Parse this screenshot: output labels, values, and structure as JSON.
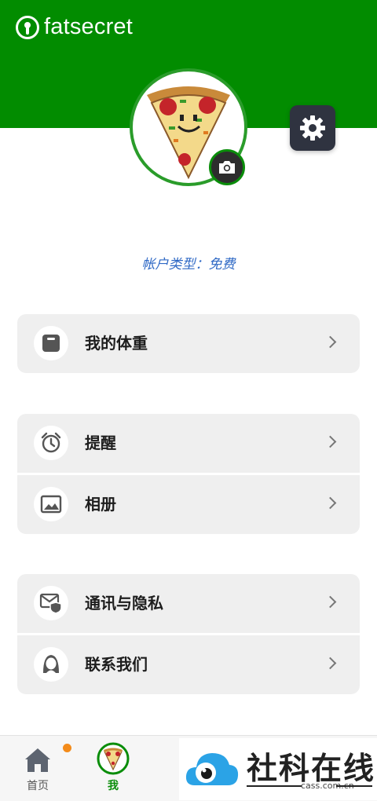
{
  "app": {
    "brand": "fatsecret",
    "brand_color": "#028c00"
  },
  "profile": {
    "avatar_icon": "pizza-slice-avatar",
    "account_type": "帐户类型：免费",
    "account_type_color": "#2f69c5"
  },
  "menu": {
    "weight": {
      "label": "我的体重",
      "icon": "scale-icon"
    },
    "reminders": {
      "label": "提醒",
      "icon": "alarm-clock-icon"
    },
    "album": {
      "label": "相册",
      "icon": "image-icon"
    },
    "privacy": {
      "label": "通讯与隐私",
      "icon": "mail-shield-icon"
    },
    "contact": {
      "label": "联系我们",
      "icon": "support-person-icon"
    }
  },
  "bottom_nav": {
    "home": {
      "label": "首页",
      "icon": "home-icon",
      "has_badge": true,
      "badge_color": "#f38b1a"
    },
    "me": {
      "label": "我",
      "icon": "pizza-avatar-icon",
      "active": true,
      "active_color": "#0a8d0a"
    }
  },
  "watermark": {
    "text": "社科在线",
    "url": "cass.com.cn"
  }
}
